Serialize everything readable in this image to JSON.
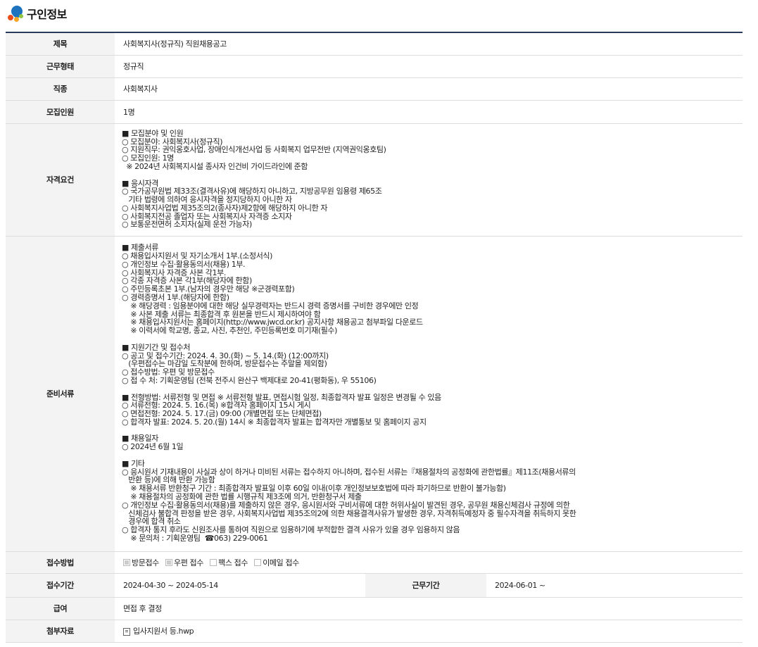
{
  "header": {
    "title": "구인정보"
  },
  "rows": {
    "title": {
      "label": "제목",
      "value": "사회복지사(정규직) 직원채용공고"
    },
    "work_type": {
      "label": "근무형태",
      "value": "정규직"
    },
    "job": {
      "label": "직종",
      "value": "사회복지사"
    },
    "headcount": {
      "label": "모집인원",
      "value": "1명"
    },
    "qualification": {
      "label": "자격요건",
      "text": "■ 모집분야 및 인원\n○ 모집분야: 사회복지사(정규직)\n○ 지원직무: 권익옹호사업, 장애인식개선사업 등 사회복지 업무전반 (지역권익옹호팀)\n○ 모집인원: 1명\n  ※ 2024년 사회복지시설 종사자 인건비 가이드라인에 준함\n\n■ 응시자격\n○ 국가공무원법 제33조(결격사유)에 해당하지 아니하고, 지방공무원 임용령 제65조\n   기타 법령에 의하여 응시자격을 정지당하지 아니한 자\n○ 사회복지사업법 제35조의2(종사자)제2항에 해당하지 아니한 자\n○ 사회복지전공 졸업자 또는 사회복지사 자격증 소지자\n○ 보통운전면허 소지자(실제 운전 가능자)"
    },
    "documents": {
      "label": "준비서류",
      "text": "■ 제출서류\n○ 채용입사지원서 및 자기소개서 1부.(소정서식)\n○ 개인정보 수집·활용동의서(채용) 1부.\n○ 사회복지사 자격증 사본 각1부.\n○ 각종 자격증 사본 각1부(해당자에 한함)\n○ 주민등록초본 1부.(남자의 경우만 해당 ※군경력포함)\n○ 경력증명서 1부.(해당자에 한함)\n    ※ 해당경력 : 임용분야에 대한 해당 실무경력자는 반드시 경력 증명서를 구비한 경우에만 인정\n    ※ 사본 제출 서류는 최종합격 후 원본을 반드시 제시하여야 함\n    ※ 채용입사지원서는 홈페이지(http://www.jwcd.or.kr) 공지사항 채용공고 첨부파일 다운로드\n    ※ 이력서에 학교명, 종교, 사진, 추천인, 주민등록번호 미기재(필수)\n\n■ 지원기간 및 접수처\n○ 공고 및 접수기간: 2024. 4. 30.(화) ~ 5. 14.(화) (12:00까지)\n   (우편접수는 마감일 도착분에 한하며, 방문접수는 주말을 제외함)\n○ 접수방법: 우편 및 방문접수\n○ 접 수 처: 기획운영팀 (전북 전주시 완산구 백제대로 20-41(평화동), 우 55106)\n\n■ 전형방법: 서류전형 및 면접 ※ 서류전형 발표, 면접시험 일정, 최종합격자 발표 일정은 변경될 수 있음\n○ 서류전형: 2024. 5. 16.(목) ※합격자 홈페이지 15시 게시\n○ 면접전형: 2024. 5. 17.(금) 09:00 (개별면접 또는 단체면접)\n○ 합격자 발표: 2024. 5. 20.(월) 14시 ※ 최종합격자 발표는 합격자만 개별통보 및 홈페이지 공지\n\n■ 채용일자\n○ 2024년 6월 1일\n\n■ 기타\n○ 응시원서 기재내용이 사실과 상이 하거나 미비된 서류는 접수하지 아니하며, 접수된 서류는『채용절차의 공정화에 관한법률』제11조(채용서류의\n   반환 등)에 의해 반환 가능함\n    ※ 채용서류 반환청구 기간 : 최종합격자 발표일 이후 60일 이내(이후 개인정보보호법에 따라 파기하므로 반환이 불가능함)\n    ※ 채용절차의 공정화에 관한 법률 시행규칙 제3조에 의거, 반환청구서 제출\n○ 개인정보 수집·활용동의서(채용)를 제출하지 않은 경우, 응시원서와 구비서류에 대한 허위사실이 발견된 경우, 공무원 채용신체검사 규정에 의한\n   신체검사 불합격 판정을 받은 경우, 사회복지사업법 제35조의2에 의한 채용결격사유가 발생한 경우, 자격취득예정자 중 필수자격을 취득하지 못한\n   경우에 합격 취소\n○ 합격자 통지 후라도 신원조사를 통하여 직원으로 임용하기에 부적합한 결격 사유가 있을 경우 임용하지 않음\n    ※ 문의처 : 기획운영팀  ☎063) 229-0061"
    },
    "method": {
      "label": "접수방법",
      "options": [
        {
          "label": "방문접수",
          "checked": true
        },
        {
          "label": "우편 접수",
          "checked": true
        },
        {
          "label": "팩스 접수",
          "checked": false
        },
        {
          "label": "이메일 접수",
          "checked": false
        }
      ]
    },
    "period": {
      "label": "접수기간",
      "value": "2024-04-30 ~ 2024-05-14",
      "label2": "근무기간",
      "value2": "2024-06-01 ~"
    },
    "salary": {
      "label": "급여",
      "value": "면접 후 결정"
    },
    "attachment": {
      "label": "첨부자료",
      "value": "입사지원서 등.hwp"
    }
  }
}
